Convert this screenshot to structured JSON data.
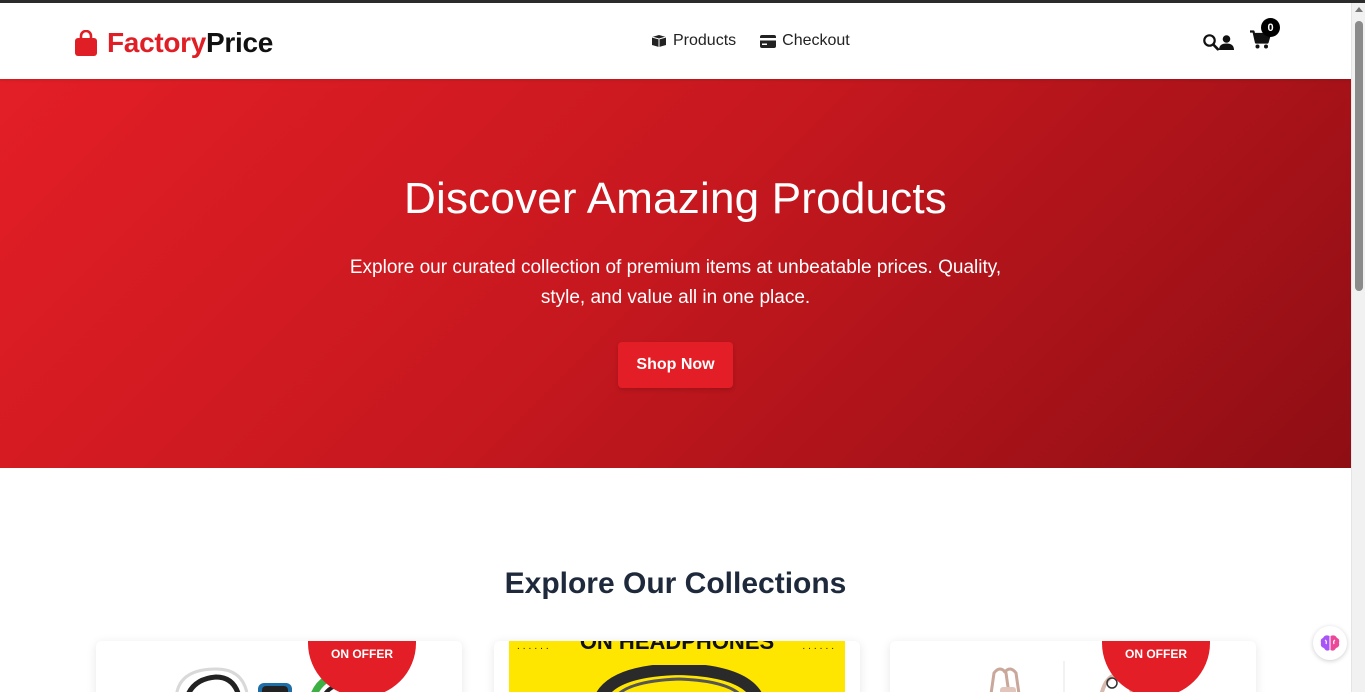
{
  "brand": {
    "name_part1": "Factory",
    "name_part2": "Price",
    "primary_color": "#e01e26"
  },
  "nav": {
    "items": [
      {
        "label": "Products",
        "icon": "box-icon"
      },
      {
        "label": "Checkout",
        "icon": "credit-card-icon"
      }
    ]
  },
  "header_actions": {
    "search_icon": "search-icon",
    "user_icon": "user-icon",
    "cart_icon": "cart-icon",
    "cart_count": "0"
  },
  "hero": {
    "title": "Discover Amazing Products",
    "subtitle": "Explore our curated collection of premium items at unbeatable prices. Quality, style, and value all in one place.",
    "cta_label": "Shop Now"
  },
  "collections": {
    "title": "Explore Our Collections",
    "cards": [
      {
        "badge": "ON OFFER"
      },
      {
        "banner_text": "ON HEADPHONES"
      },
      {
        "badge": "ON OFFER"
      }
    ]
  },
  "floating_widget": {
    "icon": "brain-icon"
  }
}
